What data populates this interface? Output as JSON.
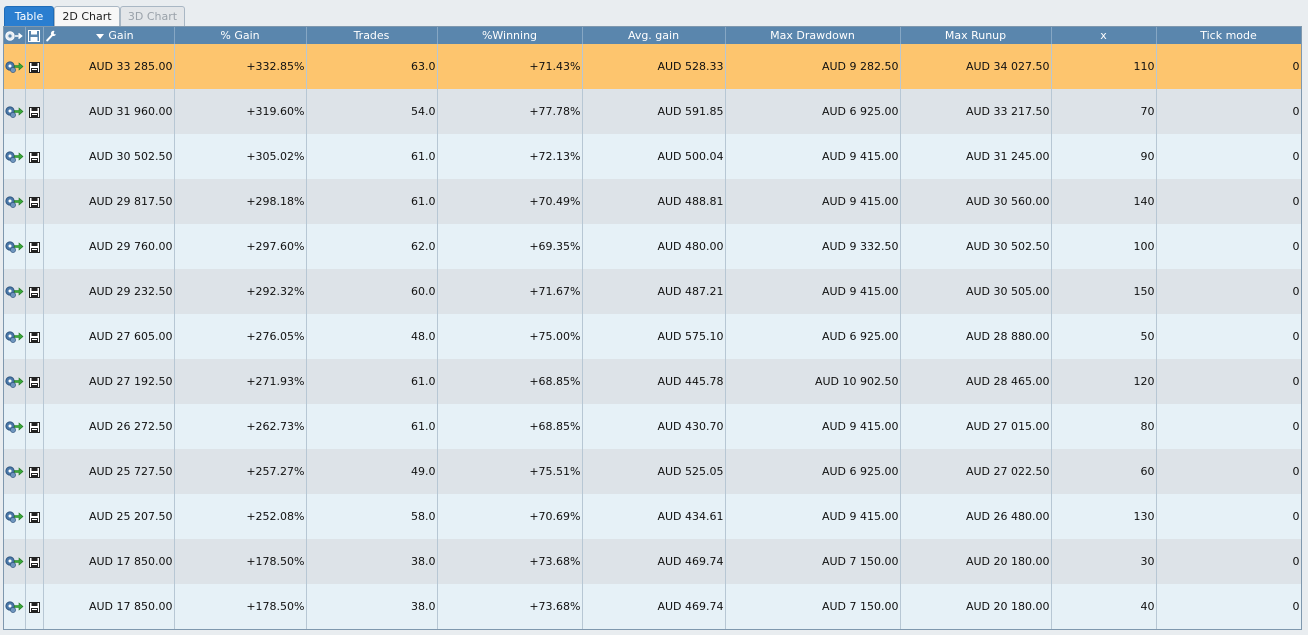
{
  "tabs": [
    {
      "label": "Table",
      "state": "active"
    },
    {
      "label": "2D Chart",
      "state": "normal"
    },
    {
      "label": "3D Chart",
      "state": "disabled"
    }
  ],
  "header_icons": [
    "run-settings-icon",
    "save-icon",
    "wrench-icon"
  ],
  "row_icons": [
    "apply-settings-icon",
    "save-icon"
  ],
  "sort": {
    "column": "Gain",
    "direction": "descending"
  },
  "columns": [
    "Gain",
    "% Gain",
    "Trades",
    "%Winning",
    "Avg. gain",
    "Max Drawdown",
    "Max Runup",
    "x",
    "Tick mode"
  ],
  "rows": [
    [
      "AUD 33 285.00",
      "+332.85%",
      "63.0",
      "+71.43%",
      "AUD 528.33",
      "AUD 9 282.50",
      "AUD 34 027.50",
      "110",
      "0"
    ],
    [
      "AUD 31 960.00",
      "+319.60%",
      "54.0",
      "+77.78%",
      "AUD 591.85",
      "AUD 6 925.00",
      "AUD 33 217.50",
      "70",
      "0"
    ],
    [
      "AUD 30 502.50",
      "+305.02%",
      "61.0",
      "+72.13%",
      "AUD 500.04",
      "AUD 9 415.00",
      "AUD 31 245.00",
      "90",
      "0"
    ],
    [
      "AUD 29 817.50",
      "+298.18%",
      "61.0",
      "+70.49%",
      "AUD 488.81",
      "AUD 9 415.00",
      "AUD 30 560.00",
      "140",
      "0"
    ],
    [
      "AUD 29 760.00",
      "+297.60%",
      "62.0",
      "+69.35%",
      "AUD 480.00",
      "AUD 9 332.50",
      "AUD 30 502.50",
      "100",
      "0"
    ],
    [
      "AUD 29 232.50",
      "+292.32%",
      "60.0",
      "+71.67%",
      "AUD 487.21",
      "AUD 9 415.00",
      "AUD 30 505.00",
      "150",
      "0"
    ],
    [
      "AUD 27 605.00",
      "+276.05%",
      "48.0",
      "+75.00%",
      "AUD 575.10",
      "AUD 6 925.00",
      "AUD 28 880.00",
      "50",
      "0"
    ],
    [
      "AUD 27 192.50",
      "+271.93%",
      "61.0",
      "+68.85%",
      "AUD 445.78",
      "AUD 10 902.50",
      "AUD 28 465.00",
      "120",
      "0"
    ],
    [
      "AUD 26 272.50",
      "+262.73%",
      "61.0",
      "+68.85%",
      "AUD 430.70",
      "AUD 9 415.00",
      "AUD 27 015.00",
      "80",
      "0"
    ],
    [
      "AUD 25 727.50",
      "+257.27%",
      "49.0",
      "+75.51%",
      "AUD 525.05",
      "AUD 6 925.00",
      "AUD 27 022.50",
      "60",
      "0"
    ],
    [
      "AUD 25 207.50",
      "+252.08%",
      "58.0",
      "+70.69%",
      "AUD 434.61",
      "AUD 9 415.00",
      "AUD 26 480.00",
      "130",
      "0"
    ],
    [
      "AUD 17 850.00",
      "+178.50%",
      "38.0",
      "+73.68%",
      "AUD 469.74",
      "AUD 7 150.00",
      "AUD 20 180.00",
      "30",
      "0"
    ],
    [
      "AUD 17 850.00",
      "+178.50%",
      "38.0",
      "+73.68%",
      "AUD 469.74",
      "AUD 7 150.00",
      "AUD 20 180.00",
      "40",
      "0"
    ]
  ],
  "selected_row": 0,
  "colors": {
    "header_bg": "#5a86ad",
    "selected_row_bg": "#fdc56e",
    "row_odd_bg": "#e6f1f7",
    "row_even_bg": "#dde3e8",
    "active_tab_bg": "#2a7ed0"
  }
}
